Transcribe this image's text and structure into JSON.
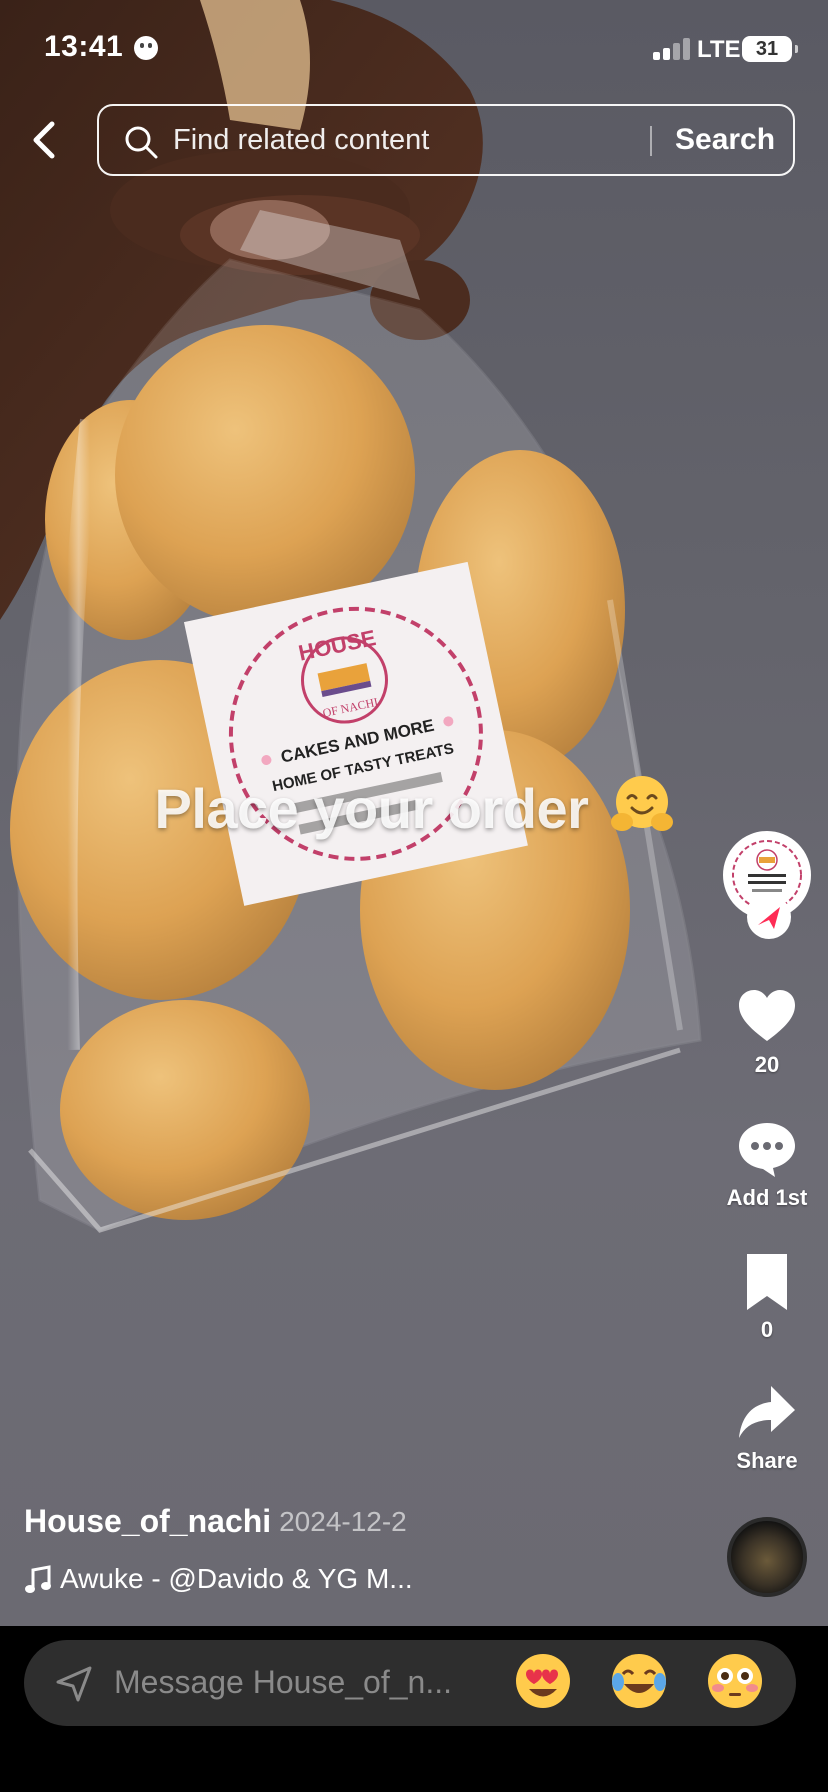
{
  "status_bar": {
    "time": "13:41",
    "network": "LTE",
    "battery": "31"
  },
  "search": {
    "placeholder": "Find related content",
    "button": "Search"
  },
  "video": {
    "overlay_text": "Place your order"
  },
  "product_label": {
    "brand_top": "HOUSE",
    "brand_bottom": "OF NACHI",
    "line1": "CAKES AND MORE",
    "line2": "HOME OF TASTY TREATS"
  },
  "actions": {
    "likes": "20",
    "comments": "Add 1st",
    "saves": "0",
    "share": "Share"
  },
  "post": {
    "author": "House_of_nachi",
    "date": "· 2024-12-2",
    "sound": "Awuke - @Davido & YG M..."
  },
  "message_bar": {
    "placeholder": "Message House_of_n..."
  },
  "emojis": [
    {
      "name": "heart-eyes",
      "color": "#FFCB4C"
    },
    {
      "name": "tears-of-joy",
      "color": "#FFCB4C"
    },
    {
      "name": "flushed",
      "color": "#FFCB4C"
    }
  ],
  "colors": {
    "background": "#616169",
    "bread": "#E2A655",
    "label_pink": "#C2406A",
    "send_red": "#FE2C55"
  }
}
